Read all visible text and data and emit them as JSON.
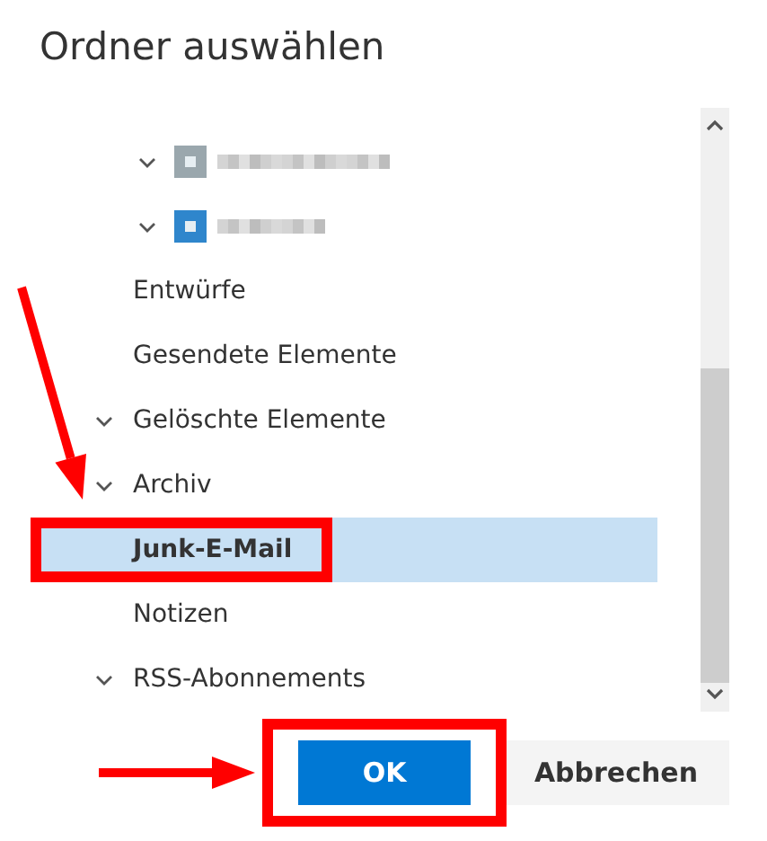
{
  "dialog": {
    "title": "Ordner auswählen",
    "folders": [
      {
        "kind": "redacted",
        "expanded": true,
        "color": "#9aa7ad"
      },
      {
        "kind": "redacted",
        "expanded": true,
        "color": "#2f86cc"
      },
      {
        "kind": "leaf",
        "label": "Entwürfe",
        "selected": false
      },
      {
        "kind": "leaf",
        "label": "Gesendete Elemente",
        "selected": false
      },
      {
        "kind": "group",
        "label": "Gelöschte Elemente",
        "expanded": true,
        "selected": false
      },
      {
        "kind": "group",
        "label": "Archiv",
        "expanded": true,
        "selected": false
      },
      {
        "kind": "leaf",
        "label": "Junk-E-Mail",
        "selected": true,
        "highlighted": true
      },
      {
        "kind": "leaf",
        "label": "Notizen",
        "selected": false
      },
      {
        "kind": "group",
        "label": "RSS-Abonnements",
        "expanded": true,
        "selected": false
      }
    ],
    "buttons": [
      {
        "kind": "primary",
        "label": "OK",
        "highlighted": true
      },
      {
        "kind": "secondary",
        "label": "Abbrechen",
        "highlighted": false
      }
    ]
  }
}
